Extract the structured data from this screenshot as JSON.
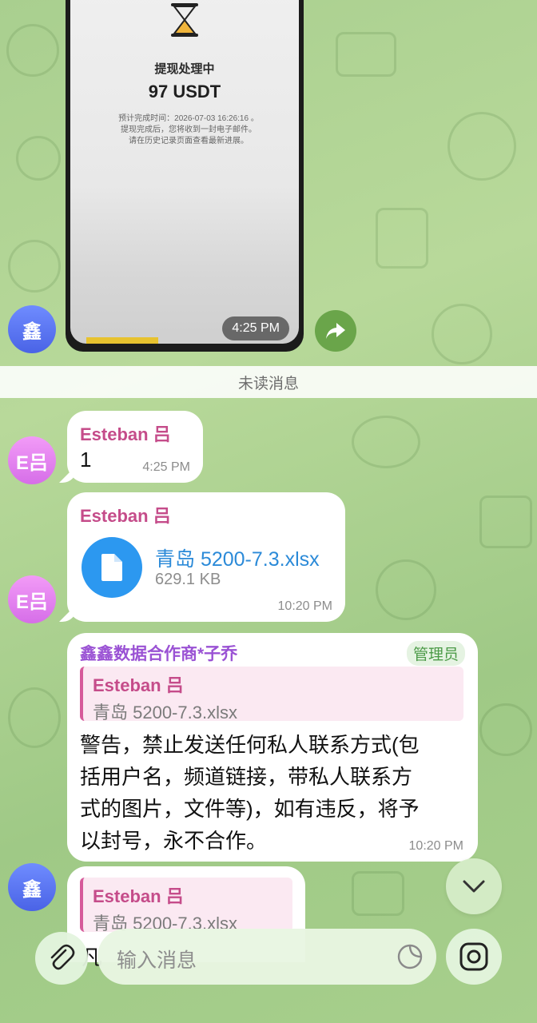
{
  "screenshot": {
    "status_title": "提现处理中",
    "amount": "97 USDT",
    "info_line1": "预计完成时间：2026-07-03 16:26:16 。",
    "info_line2": "提现完成后，您将收到一封电子邮件。",
    "info_line3": "请在历史记录页面查看最新进展。",
    "time": "4:25 PM"
  },
  "avatars": {
    "xin": "鑫",
    "esteban": "E吕"
  },
  "unread_divider": "未读消息",
  "messages": [
    {
      "sender": "Esteban 吕",
      "text": "1",
      "time": "4:25 PM"
    },
    {
      "sender": "Esteban 吕",
      "file_name": "青岛 5200-7.3.xlsx",
      "file_size": "629.1 KB",
      "time": "10:20 PM"
    },
    {
      "sender": "鑫鑫数据合作商*子乔",
      "badge": "管理员",
      "reply_name": "Esteban 吕",
      "reply_text": "青岛 5200-7.3.xlsx",
      "line1": "警告，禁止发送任何私人联系方式(包",
      "line2": "括用户名，频道链接，带私人联系方",
      "line3": "式的图片，文件等)，如有违反，将予",
      "line4": "以封号，永不合作。",
      "time": "10:20 PM"
    },
    {
      "reply_name": "Esteban 吕",
      "reply_text": "青岛 5200-7.3.xlsx",
      "partial_text": "凡"
    }
  ],
  "composer": {
    "placeholder": "输入消息"
  },
  "icons": {
    "attach": "paperclip-icon",
    "sticker": "sticker-icon",
    "camera": "camera-icon",
    "scroll": "chevron-down-icon",
    "share": "share-arrow-icon",
    "file": "document-icon"
  },
  "colors": {
    "sender": "#c54c8a",
    "file_accent": "#2c98f0",
    "admin_badge": "#4b9a47"
  }
}
